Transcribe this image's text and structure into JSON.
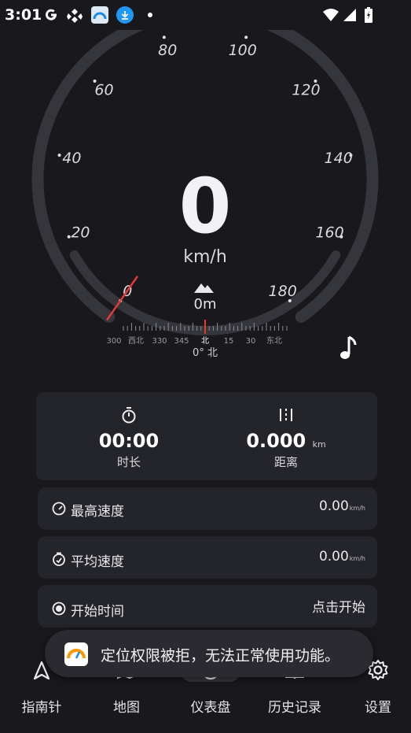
{
  "status_bar": {
    "time": "3:01",
    "icons": [
      "google-icon",
      "download-app-icon",
      "cloud-app-icon",
      "download-notify-icon",
      "dot-icon"
    ],
    "right_icons": [
      "wifi-icon",
      "signal-icon",
      "battery-icon"
    ]
  },
  "gauge": {
    "speed": "0",
    "unit": "km/h",
    "scale_labels": [
      "0",
      "20",
      "40",
      "60",
      "80",
      "100",
      "120",
      "140",
      "160",
      "180"
    ],
    "speed_value": 0,
    "speed_max": 180,
    "altitude": "0m",
    "compass_labels": [
      "300",
      "西北",
      "330",
      "345",
      "北",
      "15",
      "30",
      "东北"
    ],
    "heading": "0° 北",
    "accent_color": "#e53935"
  },
  "stats": {
    "duration_value": "00:00",
    "duration_label": "时长",
    "distance_value": "0.000",
    "distance_unit": "km",
    "distance_label": "距离"
  },
  "rows": {
    "max_speed_label": "最高速度",
    "max_speed_value": "0.00",
    "max_speed_unit": "km/h",
    "avg_speed_label": "平均速度",
    "avg_speed_value": "0.00",
    "avg_speed_unit": "km/h",
    "start_time_label": "开始时间",
    "start_time_value": "点击开始"
  },
  "toast": {
    "text": "定位权限被拒，无法正常使用功能。"
  },
  "nav": {
    "items": [
      {
        "label": "指南针",
        "icon": "compass-arrow-icon"
      },
      {
        "label": "地图",
        "icon": "map-icon"
      },
      {
        "label": "仪表盘",
        "icon": "dashboard-icon"
      },
      {
        "label": "历史记录",
        "icon": "history-icon"
      },
      {
        "label": "设置",
        "icon": "gear-icon"
      }
    ],
    "active_index": 2
  }
}
